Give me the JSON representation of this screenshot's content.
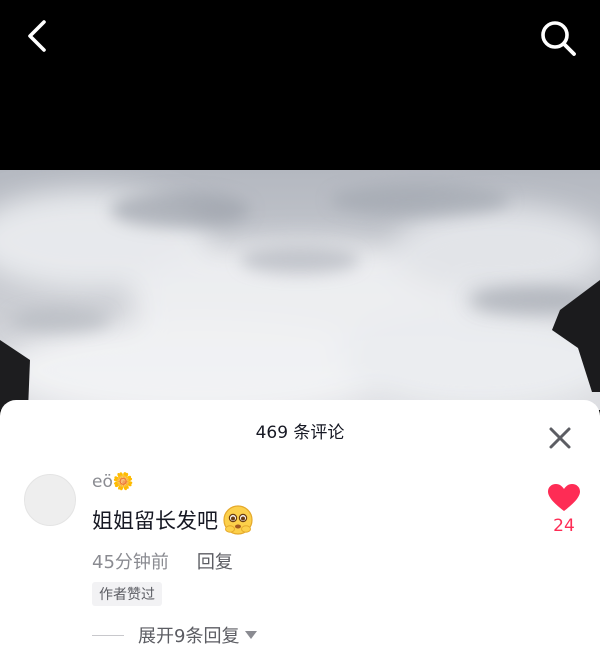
{
  "header": {
    "back_icon": "chevron-left-icon",
    "search_icon": "search-icon"
  },
  "video": {
    "description_icon": "cloudy-sky-video"
  },
  "comments": {
    "title": "469 条评论",
    "close_icon": "close-icon",
    "items": [
      {
        "username": "eö🌼",
        "text": "姐姐留长发吧",
        "emoji": "pleading-face-emoji",
        "time": "45分钟前",
        "reply_label": "回复",
        "author_badge": "作者赞过",
        "like_count": "24",
        "liked": true,
        "expand_label": "展开9条回复"
      }
    ]
  },
  "colors": {
    "like": "#fe2c55",
    "text_primary": "#161823",
    "text_secondary": "#8a8b91"
  }
}
